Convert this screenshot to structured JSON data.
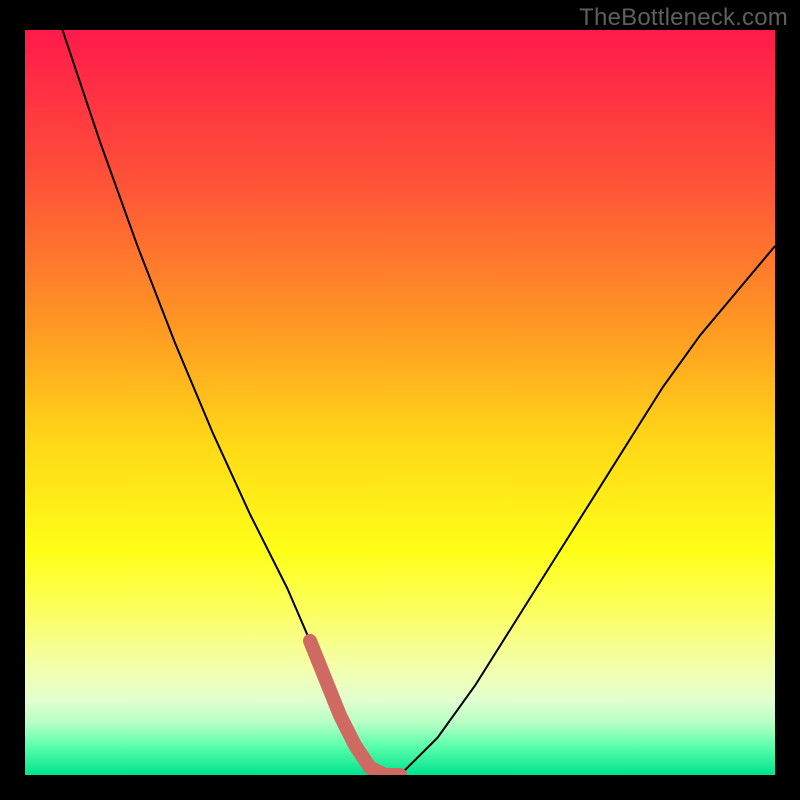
{
  "watermark": "TheBottleneck.com",
  "chart_data": {
    "type": "line",
    "title": "",
    "xlabel": "",
    "ylabel": "",
    "xlim": [
      0,
      100
    ],
    "ylim": [
      0,
      100
    ],
    "grid": false,
    "legend": false,
    "background_gradient": {
      "stops": [
        {
          "offset": 0,
          "color": "#ff1a4b"
        },
        {
          "offset": 20,
          "color": "#ff5138"
        },
        {
          "offset": 40,
          "color": "#ff9923"
        },
        {
          "offset": 55,
          "color": "#ffd717"
        },
        {
          "offset": 70,
          "color": "#ffff18"
        },
        {
          "offset": 78,
          "color": "#fbff5f"
        },
        {
          "offset": 86,
          "color": "#f3ffb0"
        },
        {
          "offset": 90,
          "color": "#e1ffd0"
        },
        {
          "offset": 93,
          "color": "#b7ffc4"
        },
        {
          "offset": 96,
          "color": "#5effad"
        },
        {
          "offset": 100,
          "color": "#00e38e"
        }
      ]
    },
    "series": [
      {
        "name": "curve",
        "color": "#000000",
        "stroke_width": 2,
        "x": [
          5,
          10,
          15,
          20,
          25,
          30,
          35,
          38,
          40,
          42,
          44,
          46,
          48,
          50,
          55,
          60,
          65,
          70,
          75,
          80,
          85,
          90,
          95,
          100
        ],
        "y": [
          100,
          85,
          71,
          58,
          46,
          35,
          25,
          18,
          13,
          8,
          4,
          1,
          0,
          0,
          5,
          12,
          20,
          28,
          36,
          44,
          52,
          59,
          65,
          71
        ]
      },
      {
        "name": "highlight",
        "color": "#cf6a63",
        "stroke_width": 14,
        "linecap": "round",
        "x": [
          38,
          40,
          42,
          44,
          46,
          48,
          50
        ],
        "y": [
          18,
          13,
          8,
          4,
          1,
          0,
          0
        ]
      }
    ]
  }
}
